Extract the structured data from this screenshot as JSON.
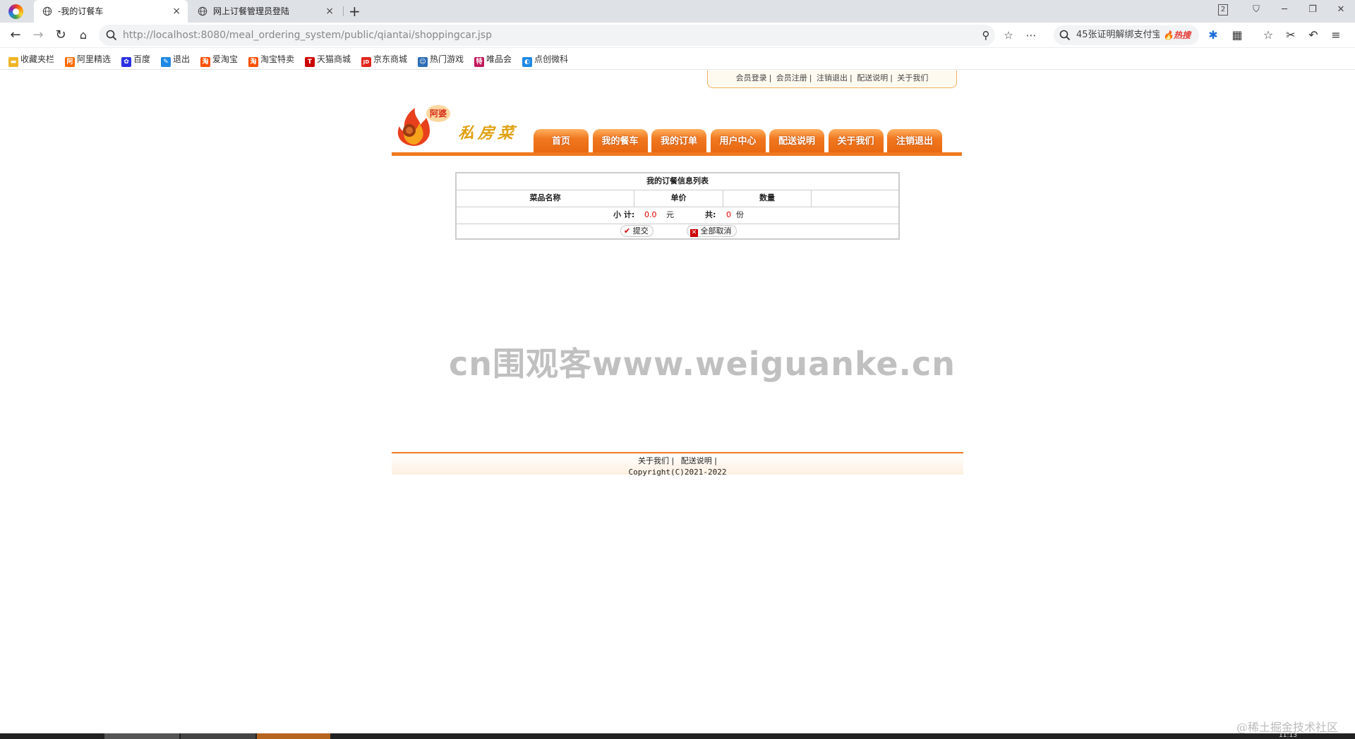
{
  "browser": {
    "tabs": [
      {
        "title": "-我的订餐车",
        "close": "×",
        "active": true
      },
      {
        "title": "网上订餐管理员登陆",
        "close": "×",
        "active": false
      }
    ],
    "new_tab": "+",
    "window_controls": {
      "tab_count": "2",
      "minimize": "─",
      "restore": "❐",
      "close": "✕"
    },
    "address": "http://localhost:8080/meal_ordering_system/public/qiantai/shoppingcar.jsp",
    "search": {
      "text": "45张证明解绑支付宝",
      "hot_label": "热搜"
    },
    "bookmarks": [
      {
        "label": "收藏夹栏",
        "icon": "folder-icon",
        "color": "#f0b429"
      },
      {
        "label": "阿里精选",
        "icon": "ali-icon",
        "color": "#ff6a00"
      },
      {
        "label": "百度",
        "icon": "baidu-paw-icon",
        "color": "#2932e1"
      },
      {
        "label": "退出",
        "icon": "feather-icon",
        "color": "#1e88e5"
      },
      {
        "label": "爱淘宝",
        "icon": "taobao-icon",
        "color": "#ff5000"
      },
      {
        "label": "淘宝特卖",
        "icon": "taobao-icon",
        "color": "#ff5000"
      },
      {
        "label": "天猫商城",
        "icon": "tmall-icon",
        "color": "#c00"
      },
      {
        "label": "京东商城",
        "icon": "jd-icon",
        "color": "#e1251b"
      },
      {
        "label": "热门游戏",
        "icon": "game-icon",
        "color": "#2d6db5"
      },
      {
        "label": "唯品会",
        "icon": "vip-icon",
        "color": "#c2185b"
      },
      {
        "label": "点创微科",
        "icon": "bird-icon",
        "color": "#1e88e5"
      }
    ]
  },
  "site": {
    "top_links": [
      "会员登录",
      "会员注册",
      "注销退出",
      "配送说明",
      "关于我们"
    ],
    "logo": {
      "badge": "阿婆",
      "text": "私房菜"
    },
    "nav": [
      "首页",
      "我的餐车",
      "我的订单",
      "用户中心",
      "配送说明",
      "关于我们",
      "注销退出"
    ]
  },
  "cart": {
    "title": "我的订餐信息列表",
    "columns": [
      "菜品名称",
      "单价",
      "数量",
      ""
    ],
    "subtotal_label": "小 计:",
    "subtotal_value": "0.0",
    "subtotal_unit": "元",
    "count_label": "共:",
    "count_value": "0",
    "count_unit": "份",
    "submit_label": "提交",
    "cancel_all_label": "全部取消"
  },
  "watermark": "cn围观客www.weiguanke.cn",
  "footer": {
    "links": [
      "关于我们",
      "配送说明"
    ],
    "copyright": "Copyright(C)2021-2022"
  },
  "overlay": {
    "juejin": "@稀土掘金技术社区",
    "clock": "11:13"
  },
  "colors": {
    "accent": "#f07820",
    "price_red": "#d00"
  }
}
